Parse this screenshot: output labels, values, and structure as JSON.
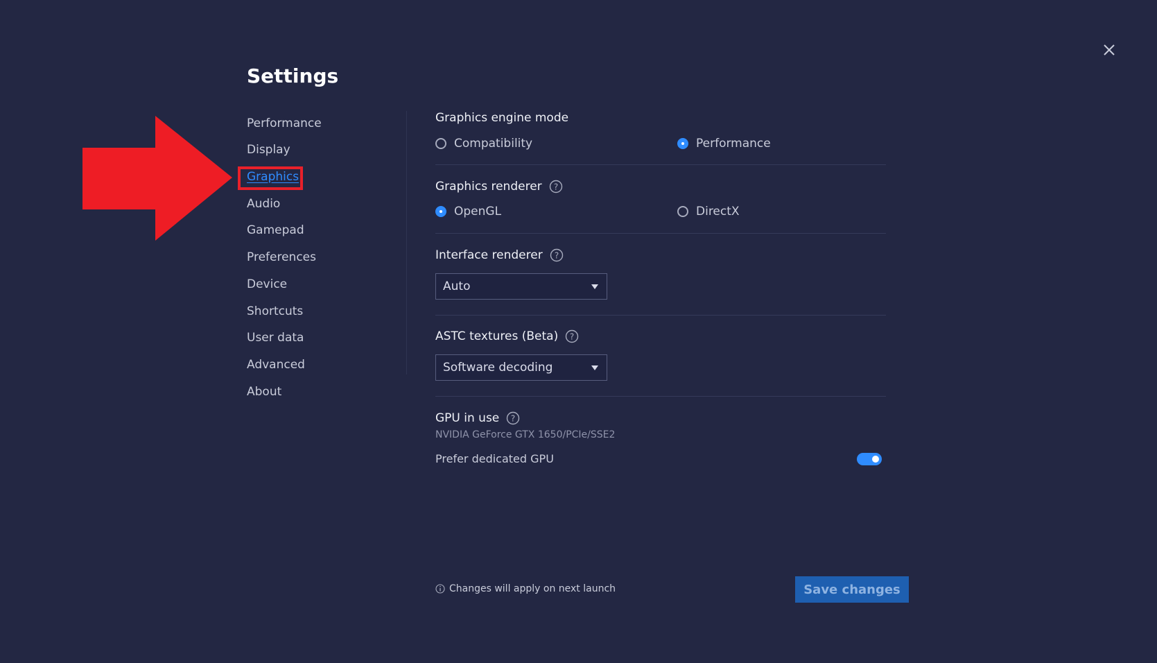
{
  "header": {
    "title": "Settings"
  },
  "sidebar": {
    "items": [
      {
        "label": "Performance"
      },
      {
        "label": "Display"
      },
      {
        "label": "Graphics",
        "active": true
      },
      {
        "label": "Audio"
      },
      {
        "label": "Gamepad"
      },
      {
        "label": "Preferences"
      },
      {
        "label": "Device"
      },
      {
        "label": "Shortcuts"
      },
      {
        "label": "User data"
      },
      {
        "label": "Advanced"
      },
      {
        "label": "About"
      }
    ]
  },
  "graphics": {
    "engine_mode": {
      "title": "Graphics engine mode",
      "options": [
        {
          "label": "Compatibility",
          "selected": false
        },
        {
          "label": "Performance",
          "selected": true
        }
      ]
    },
    "renderer": {
      "title": "Graphics renderer",
      "options": [
        {
          "label": "OpenGL",
          "selected": true
        },
        {
          "label": "DirectX",
          "selected": false
        }
      ]
    },
    "interface_renderer": {
      "title": "Interface renderer",
      "value": "Auto"
    },
    "astc": {
      "title": "ASTC textures (Beta)",
      "value": "Software decoding"
    },
    "gpu": {
      "title": "GPU in use",
      "name": "NVIDIA GeForce GTX 1650/PCIe/SSE2",
      "prefer_label": "Prefer dedicated GPU",
      "prefer_enabled": true
    }
  },
  "footer": {
    "note": "Changes will apply on next launch",
    "save_label": "Save changes"
  },
  "colors": {
    "background": "#232743",
    "accent": "#2f8cff",
    "highlight": "#e8202a"
  },
  "icons": {
    "close": "close-icon",
    "help": "question-circle-icon",
    "info": "info-icon",
    "annotation": "red-arrow-icon"
  }
}
